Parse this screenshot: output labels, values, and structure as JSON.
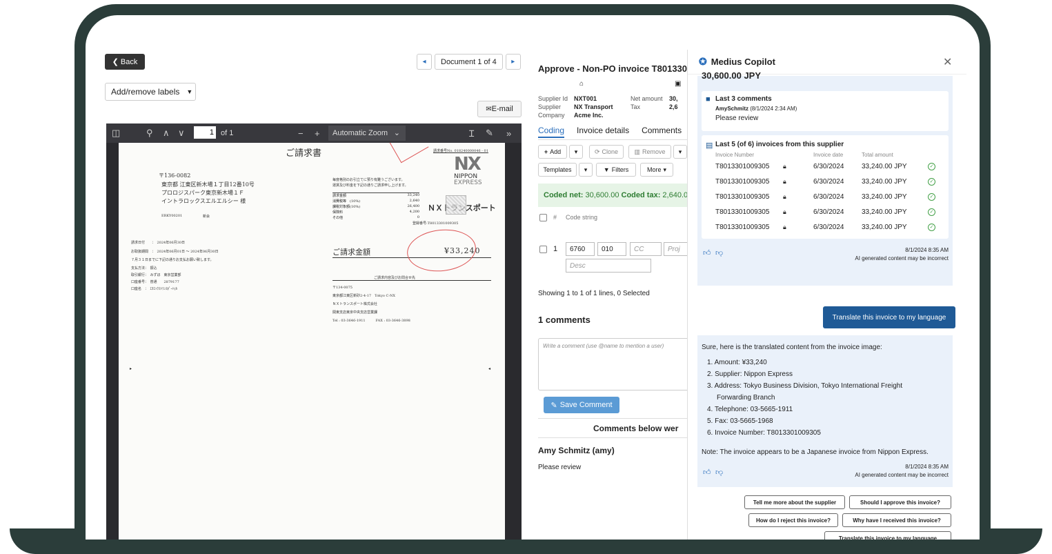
{
  "toolbar": {
    "back": "Back",
    "document_nav": "Document 1 of 4",
    "labels": "Add/remove labels",
    "email": "E-mail"
  },
  "pdf": {
    "page_current": "1",
    "page_total": "of 1",
    "zoom": "Automatic Zoom",
    "doc_title": "ご請求書",
    "postal": "〒136-0082",
    "address1": "東京都 江東区新木場１丁目12番10号",
    "address2": "プロロジスパーク東京新木場１Ｆ",
    "address3": "イントラロックスエルエルシー 様",
    "code": "ERKY00201",
    "code_note": "新会",
    "logo_text": "NX",
    "logo_sub1": "NIPPON",
    "logo_sub2": "EXPRESS",
    "invoice_no_label": "請求番号No. 018240000046 - 01",
    "greeting1": "毎度格別のお引立てに預り有難うございます。",
    "greeting2": "運賃及び料金を下記の通りご請求申し上げます。",
    "breakdown": [
      {
        "label": "請求金額",
        "value": "33,240"
      },
      {
        "label": "消費税等　(10%)",
        "value": "2,640"
      },
      {
        "label": "課税対象額(10%)",
        "value": "26,400"
      },
      {
        "label": "保険料",
        "value": "4,200"
      },
      {
        "label": "その他",
        "value": "0"
      }
    ],
    "company_name": "ＮＸトランスポート",
    "reg_no": "登録番号:T8013301009305",
    "invoice_date": "請求日付　　：　2024年06月30日",
    "period": "お取扱期間　：　2024年06月01日 〜 2024年06月30日",
    "payment_note": "７月３１日までに下記の通りお支払お願い致します。",
    "payment_method": "支払方法：　振込",
    "bank": "取引銀行：　みずほ　東京営業部",
    "account": "口座番号：　普通　　2879177",
    "account_name": "口座名　：　ｴﾇｴｯｸｽﾄﾗﾝｽﾎﾟｰﾄ(ｶ",
    "total_label": "ご請求金額",
    "total_value": "¥33,240",
    "contact_label": "ご請求内容及びお問合せ先",
    "contact1": "〒134-0075",
    "contact2": "東京都江東区新砂2-4-17　Tokyo C-NX",
    "contact3": "ＮＸトランスポート株式会社",
    "contact4": "関東支店東京中央支店営業課",
    "contact5": "Tel : 03-3646-1911　　　FAX : 03-3646-3898"
  },
  "approve": {
    "title": "Approve - Non-PO invoice T801330",
    "supplier_id_label": "Supplier Id",
    "supplier_id": "NXT001",
    "supplier_label": "Supplier",
    "supplier": "NX Transport",
    "company_label": "Company",
    "company": "Acme Inc.",
    "net_label": "Net amount",
    "net_value": "30,",
    "tax_label": "Tax",
    "tax_value": "2,6",
    "tabs": [
      "Coding",
      "Invoice details",
      "Comments"
    ],
    "add": "Add",
    "clone": "Clone",
    "remove": "Remove",
    "templates": "Templates",
    "filters": "Filters",
    "more": "More",
    "coded_net_label": "Coded net:",
    "coded_net": "30,600.00",
    "coded_tax_label": "Coded tax:",
    "coded_tax": "2,640.00",
    "col_hash": "#",
    "col_code": "Code string",
    "row_num": "1",
    "row_cells": [
      "6760",
      "010"
    ],
    "row_placeholders": [
      "CC",
      "Proj",
      "Desc"
    ],
    "showing": "Showing 1 to 1 of 1 lines, 0 Selected",
    "comments_title": "1 comments",
    "comment_placeholder": "Write a comment (use @name to mention a user)",
    "save_comment": "Save Comment",
    "comments_below": "Comments below wer",
    "comment_author": "Amy Schmitz (amy)",
    "comment_text": "Please review"
  },
  "copilot": {
    "title": "Medius Copilot",
    "cut_amount": "30,600.00 JPY",
    "last_comments_title": "Last 3 comments",
    "last_comment_author": "AmySchmitz",
    "last_comment_time": "(8/1/2024 2:34 AM)",
    "last_comment_text": "Please review",
    "last_invoices_title": "Last 5 (of 6) invoices from this supplier",
    "inv_headers": [
      "Invoice Number",
      "Invoice date",
      "Total amount"
    ],
    "invoices": [
      {
        "number": "T8013301009305",
        "date": "6/30/2024",
        "amount": "33,240.00 JPY"
      },
      {
        "number": "T8013301009305",
        "date": "6/30/2024",
        "amount": "33,240.00 JPY"
      },
      {
        "number": "T8013301009305",
        "date": "6/30/2024",
        "amount": "33,240.00 JPY"
      },
      {
        "number": "T8013301009305",
        "date": "6/30/2024",
        "amount": "33,240.00 JPY"
      },
      {
        "number": "T8013301009305",
        "date": "6/30/2024",
        "amount": "33,240.00 JPY"
      }
    ],
    "card1_time": "8/1/2024 8:35 AM",
    "ai_disclaimer": "AI generated content may be incorrect",
    "user_prompt": "Translate this invoice to my language",
    "answer_intro": "Sure, here is the translated content from the invoice image:",
    "answer_items": [
      "1. Amount: ¥33,240",
      "2. Supplier: Nippon Express",
      "3. Address: Tokyo Business Division, Tokyo International Freight",
      "Forwarding Branch",
      "4. Telephone: 03-5665-1911",
      "5. Fax: 03-5665-1968",
      "6. Invoice Number: T8013301009305"
    ],
    "answer_note": "Note: The invoice appears to be a Japanese invoice from Nippon Express.",
    "card2_time": "8/1/2024 8:35 AM",
    "suggestions": [
      "Tell me more about the supplier",
      "Should I approve this invoice?",
      "How do I reject this invoice?",
      "Why have I received this invoice?",
      "Translate this invoice to my language"
    ]
  },
  "colors": {
    "frame": "#2b3d3a",
    "accent": "#2a6ebb",
    "primary_button": "#1f5a96",
    "card_bg": "#eaf1fa",
    "success": "#43a047"
  }
}
